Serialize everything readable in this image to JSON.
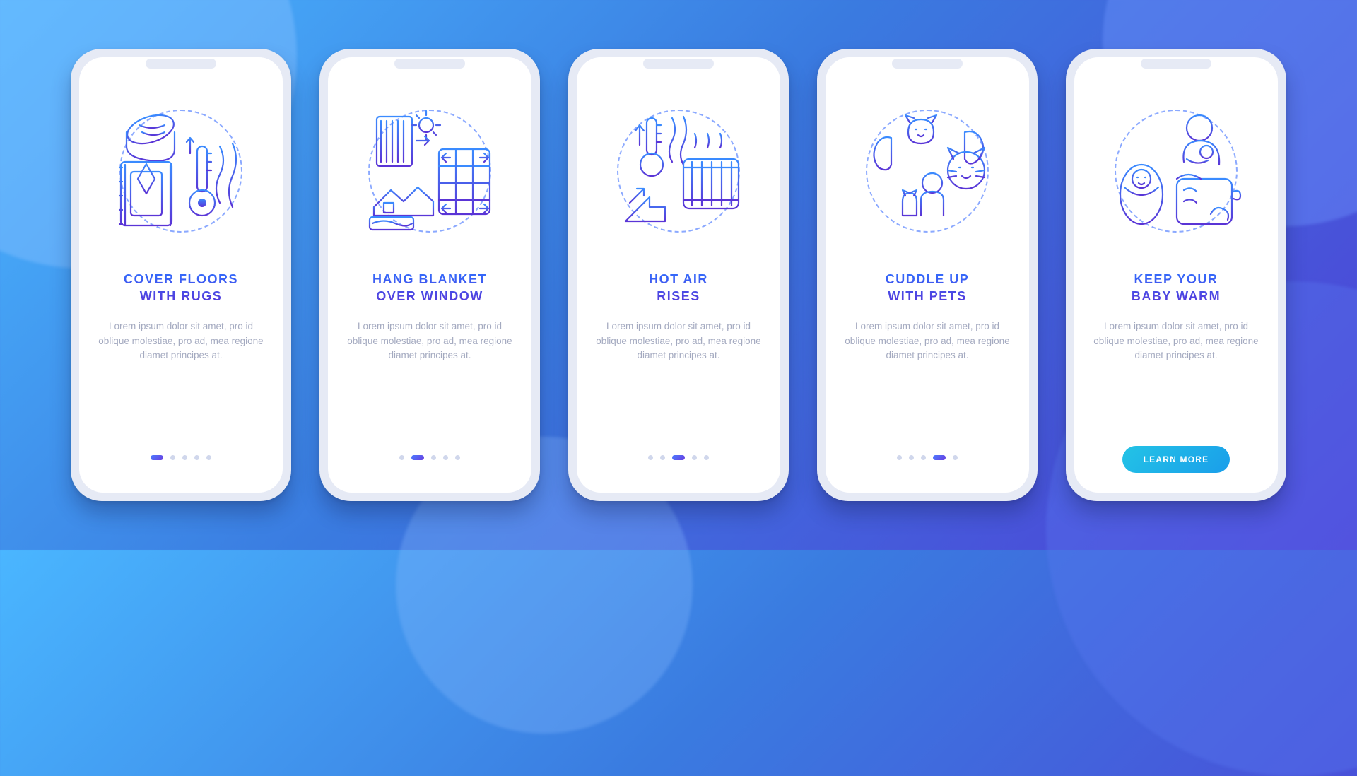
{
  "screens": [
    {
      "title": "COVER FLOORS\nWITH RUGS",
      "desc": "Lorem ipsum dolor sit amet, pro id oblique molestiae, pro ad, mea regione diamet principes at.",
      "icon": "rug-thermometer-icon",
      "activeDot": 0
    },
    {
      "title": "HANG BLANKET\nOVER WINDOW",
      "desc": "Lorem ipsum dolor sit amet, pro id oblique molestiae, pro ad, mea regione diamet principes at.",
      "icon": "blanket-window-icon",
      "activeDot": 1
    },
    {
      "title": "HOT AIR\nRISES",
      "desc": "Lorem ipsum dolor sit amet, pro id oblique molestiae, pro ad, mea regione diamet principes at.",
      "icon": "hot-air-radiator-icon",
      "activeDot": 2
    },
    {
      "title": "CUDDLE UP\nWITH PETS",
      "desc": "Lorem ipsum dolor sit amet, pro id oblique molestiae, pro ad, mea regione diamet principes at.",
      "icon": "pets-cuddle-icon",
      "activeDot": 3
    },
    {
      "title": "KEEP YOUR\nBABY WARM",
      "desc": "Lorem ipsum dolor sit amet, pro id oblique molestiae, pro ad, mea regione diamet principes at.",
      "icon": "baby-warm-icon",
      "activeDot": 4,
      "cta": "LEARN MORE"
    }
  ],
  "dotsCount": 5,
  "colors": {
    "gradStart": "#3a8bff",
    "gradEnd": "#5a34d6",
    "cta1": "#23c3e6",
    "cta2": "#1a9eea"
  }
}
